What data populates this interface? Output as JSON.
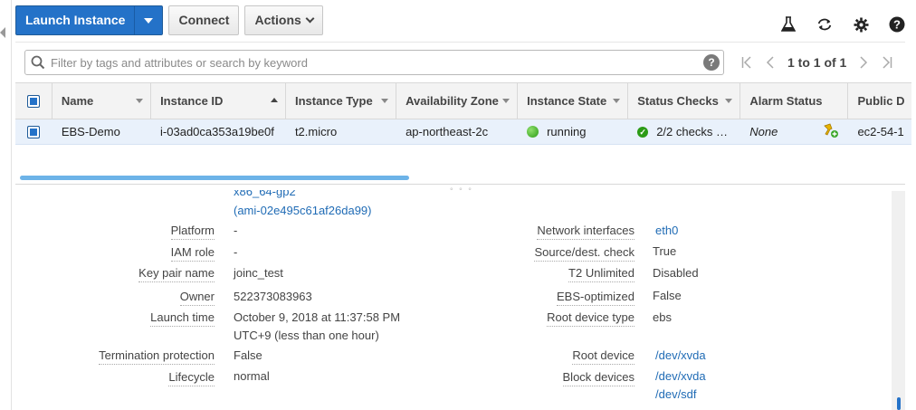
{
  "toolbar": {
    "launch_label": "Launch Instance",
    "connect_label": "Connect",
    "actions_label": "Actions"
  },
  "top_icons": [
    "flask-icon",
    "refresh-icon",
    "gear-icon",
    "help-icon"
  ],
  "search": {
    "placeholder": "Filter by tags and attributes or search by keyword",
    "help": "?"
  },
  "pager": {
    "text": "1 to 1 of 1"
  },
  "table": {
    "columns": [
      "Name",
      "Instance ID",
      "Instance Type",
      "Availability Zone",
      "Instance State",
      "Status Checks",
      "Alarm Status",
      "Public D"
    ],
    "row": {
      "name": "EBS-Demo",
      "instance_id": "i-03ad0ca353a19be0f",
      "instance_type": "t2.micro",
      "az": "ap-northeast-2c",
      "state": "running",
      "status_checks": "2/2 checks …",
      "alarm_status": "None",
      "public_dns": "ec2-54-1"
    }
  },
  "details": {
    "cut_top": "x86_64-gp2",
    "ami": "(ami-02e495c61af26da99)",
    "left": [
      {
        "label": "Platform",
        "value": "-"
      },
      {
        "label": "IAM role",
        "value": "-"
      },
      {
        "label": "Key pair name",
        "value": "joinc_test"
      },
      {
        "label": "Owner",
        "value": "522373083963"
      },
      {
        "label": "Launch time",
        "value": "October 9, 2018 at 11:37:58 PM",
        "value2": "UTC+9 (less than one hour)"
      },
      {
        "label": "Termination protection",
        "value": "False"
      },
      {
        "label": "Lifecycle",
        "value": "normal"
      }
    ],
    "right": [
      {
        "label": "Network interfaces",
        "value": "eth0"
      },
      {
        "label": "Source/dest. check",
        "value": "True"
      },
      {
        "label": "T2 Unlimited",
        "value": "Disabled"
      },
      {
        "label": "EBS-optimized",
        "value": "False"
      },
      {
        "label": "Root device type",
        "value": "ebs"
      },
      {
        "label": "Root device",
        "value": "/dev/xvda"
      },
      {
        "label": "Block devices",
        "value": "/dev/xvda",
        "value2": "/dev/sdf"
      }
    ]
  },
  "colors": {
    "primary": "#2472c8",
    "link": "#1f6bb5",
    "running": "#2c9b16",
    "selected_row": "#e9f1fb"
  }
}
